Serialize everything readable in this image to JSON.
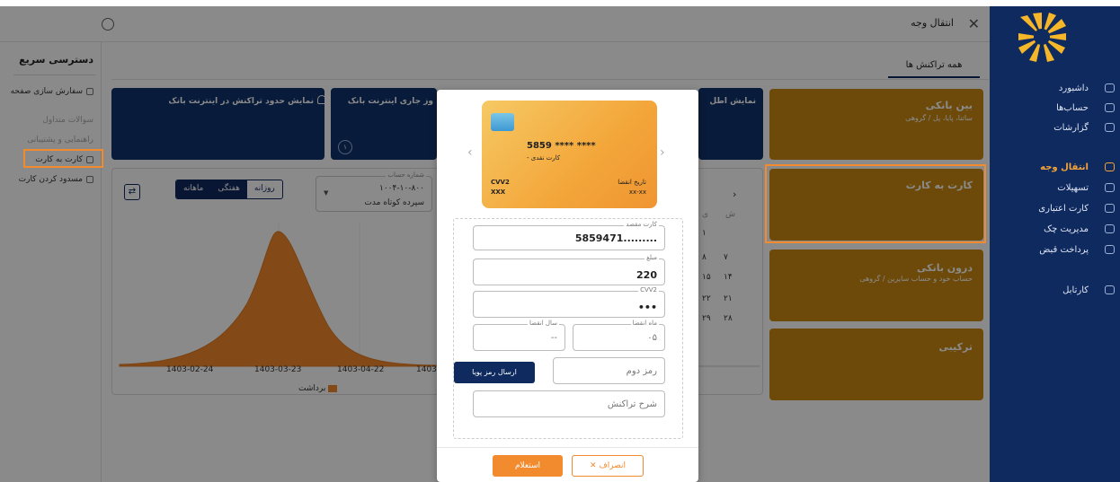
{
  "topbar": {
    "title": "انتقال وجه",
    "close_icon": "close-icon",
    "user_icon": "user-icon"
  },
  "quick_access": {
    "title": "دسترسی سریع",
    "items": [
      {
        "label": "سفارش سازی صفحه",
        "icon": "settings-icon",
        "faded": false
      },
      {
        "label": "سوالات متداول",
        "icon": "",
        "faded": true
      },
      {
        "label": "راهنمایی و پشتیبانی",
        "icon": "",
        "faded": true
      },
      {
        "label": "کارت به کارت",
        "icon": "card-icon",
        "faded": false
      },
      {
        "label": "مسدود کردن کارت",
        "icon": "card-block-icon",
        "faded": false
      }
    ]
  },
  "sidebar": {
    "items": [
      {
        "label": "داشبورد",
        "icon": "dashboard-icon",
        "active": false
      },
      {
        "label": "حساب‌ها",
        "icon": "bank-icon",
        "active": false
      },
      {
        "label": "گزارشات",
        "icon": "report-icon",
        "active": false
      },
      {
        "label": "انتقال وجه",
        "icon": "transfer-icon",
        "active": true
      },
      {
        "label": "تسهیلات",
        "icon": "loan-icon",
        "active": false
      },
      {
        "label": "کارت اعتباری",
        "icon": "credit-card-icon",
        "active": false
      },
      {
        "label": "مدیریت چک",
        "icon": "cheque-icon",
        "active": false
      },
      {
        "label": "پرداخت قبض",
        "icon": "bill-icon",
        "active": false
      },
      {
        "label": "کارتابل",
        "icon": "cartable-icon",
        "active": false
      }
    ]
  },
  "main": {
    "tab_all": "همه تراکنش ها",
    "info_cards": [
      {
        "title": "نمایش حدود تراکنش در اینترنت بانک"
      },
      {
        "title": "وز جاری اینترنت بانک"
      },
      {
        "title": "نمایش اطل"
      }
    ],
    "info_card_badge": "۱",
    "op_cards": [
      {
        "title": "بین بانکی",
        "subtitle": "ساتنا، پایا، پل / گروهی"
      },
      {
        "title": "کارت به کارت",
        "subtitle": ""
      },
      {
        "title": "درون بانکی",
        "subtitle": "حساب خود و حساب سایرین / گروهی"
      },
      {
        "title": "ترکیبی",
        "subtitle": ""
      }
    ],
    "chart": {
      "period_tabs": [
        "روزانه",
        "هفتگی",
        "ماهانه"
      ],
      "active_period": "ماهانه",
      "account_label": "شماره حساب",
      "account_number": "۱۰۰۴-۱۰-۸۰۰",
      "account_type": "سپرده کوتاه مدت",
      "x_ticks": [
        "1403-02-24",
        "1403-03-23",
        "1403-04-22",
        "1403-"
      ],
      "legend": "برداشت"
    },
    "calendar": {
      "header": [
        "ش",
        "ی"
      ],
      "cells": [
        "۱",
        "۸",
        "۷",
        "۱۵",
        "۱۴",
        "۲۲",
        "۲۱",
        "۲۹",
        "۲۸"
      ]
    }
  },
  "modal": {
    "card": {
      "number": "5859 **** ****",
      "type": "- کارت نقدی",
      "cvv_label": "CVV2",
      "cvv_value": "XXX",
      "expiry_label": "تاریخ انقضا",
      "expiry_value": "xx-xx"
    },
    "fields": {
      "dest_card_label": "کارت مقصد",
      "dest_card_value": "5859471.........",
      "amount_label": "مبلغ",
      "amount_value": "220",
      "cvv_label": "CVV2",
      "cvv_value": "•••",
      "exp_month_label": "ماه انقضا",
      "exp_month_value": "۰۵",
      "exp_year_label": "سال انقضا",
      "exp_year_value": "--",
      "otp_placeholder": "رمز دوم",
      "desc_placeholder": "شرح تراکنش"
    },
    "otp_button": "ارسال رمز پویا",
    "confirm_button": "استعلام",
    "cancel_button": "انصراف"
  },
  "colors": {
    "navy": "#0f2a5e",
    "orange": "#f28a2e",
    "gold": "#c98a12"
  }
}
